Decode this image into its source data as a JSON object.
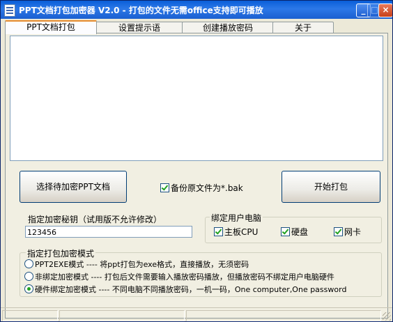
{
  "window": {
    "title": "PPT文档打包加密器 V2.0 - 打包的文件无需office支持即可播放"
  },
  "tabs": [
    {
      "label": "PPT文档打包"
    },
    {
      "label": "设置提示语"
    },
    {
      "label": "创建播放密码"
    },
    {
      "label": "关于"
    }
  ],
  "buttons": {
    "select_ppt": "选择待加密PPT文档",
    "start_pack": "开始打包"
  },
  "backup": {
    "label": "备份原文件为*.bak",
    "checked": true
  },
  "key": {
    "label": "指定加密秘钥（试用版不允许修改）",
    "value": "123456"
  },
  "bind_pc": {
    "title": "绑定用户电脑",
    "options": [
      {
        "label": "主板CPU",
        "checked": true
      },
      {
        "label": "硬盘",
        "checked": true
      },
      {
        "label": "网卡",
        "checked": true
      }
    ]
  },
  "mode": {
    "title": "指定打包加密模式",
    "options": [
      {
        "label": "PPT2EXE模式 ---- 将ppt打包为exe格式，直接播放，无须密码",
        "selected": false
      },
      {
        "label": "非绑定加密模式 ---- 打包后文件需要输入播放密码播放，但播放密码不绑定用户电脑硬件",
        "selected": false
      },
      {
        "label": "硬件绑定加密模式 ---- 不同电脑不同播放密码，一机一码，One computer,One password",
        "selected": true
      }
    ]
  },
  "colors": {
    "title_bar": "#1a5fd0",
    "active_tab_accent": "#e68b2c",
    "check_mark": "#21a121"
  }
}
